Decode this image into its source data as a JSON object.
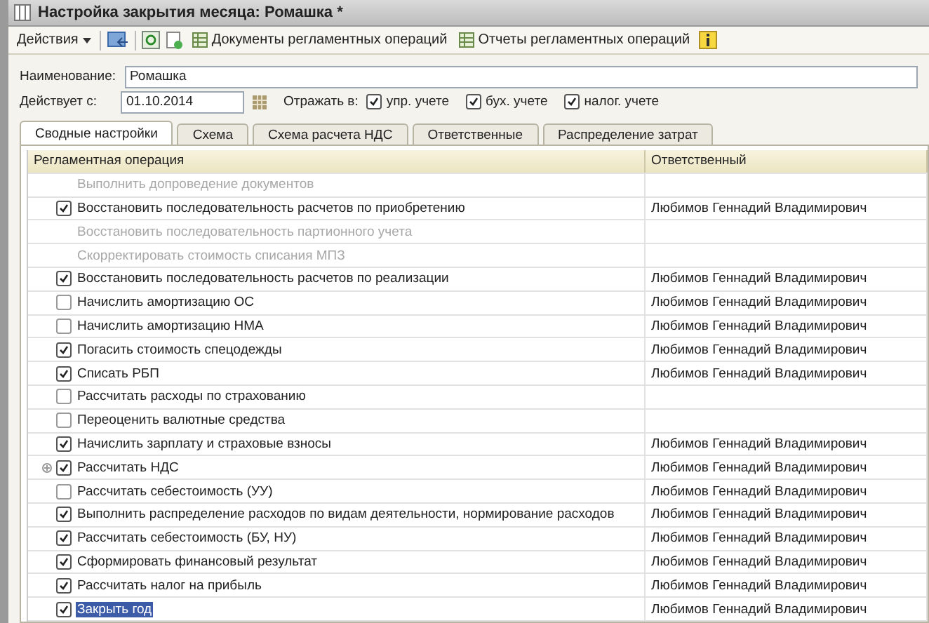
{
  "window": {
    "title": "Настройка закрытия месяца: Ромашка *"
  },
  "toolbar": {
    "actions_menu": "Действия",
    "buttons": [
      {
        "kind": "icon"
      },
      {
        "kind": "icon"
      },
      {
        "kind": "icon"
      },
      {
        "kind": "text",
        "label": "Документы регламентных операций"
      },
      {
        "kind": "text",
        "label": "Отчеты регламентных операций"
      },
      {
        "kind": "icon"
      }
    ]
  },
  "form": {
    "name_label": "Наименование:",
    "name_value": "Ромашка",
    "date_label": "Действует с:",
    "date_value": "01.10.2014",
    "reflect_label": "Отражать в:",
    "reflect": [
      {
        "label": "упр. учете",
        "checked": true
      },
      {
        "label": "бух. учете",
        "checked": true
      },
      {
        "label": "налог. учете",
        "checked": true
      }
    ]
  },
  "tabs": [
    {
      "label": "Сводные настройки",
      "selected": true
    },
    {
      "label": "Схема",
      "selected": false
    },
    {
      "label": "Схема расчета НДС",
      "selected": false
    },
    {
      "label": "Ответственные",
      "selected": false
    },
    {
      "label": "Распределение затрат",
      "selected": false
    }
  ],
  "table": {
    "columns": [
      "Регламентная операция",
      "Ответственный"
    ],
    "rows": [
      {
        "operation": "Выполнить допроведение документов",
        "disabled": true,
        "responsible": "",
        "selected": false
      },
      {
        "operation": "Восстановить последовательность расчетов по приобретению",
        "disabled": false,
        "checked": true,
        "responsible": "Любимов Геннадий Владимирович",
        "selected": false
      },
      {
        "operation": "Восстановить последовательность партионного учета",
        "disabled": true,
        "responsible": "",
        "selected": false
      },
      {
        "operation": "Скорректировать стоимость списания МПЗ",
        "disabled": true,
        "responsible": "",
        "selected": false
      },
      {
        "operation": "Восстановить последовательность расчетов по реализации",
        "disabled": false,
        "checked": true,
        "responsible": "Любимов Геннадий Владимирович",
        "selected": false
      },
      {
        "operation": "Начислить амортизацию ОС",
        "disabled": false,
        "checked": false,
        "responsible": "Любимов Геннадий Владимирович",
        "selected": false
      },
      {
        "operation": "Начислить амортизацию НМА",
        "disabled": false,
        "checked": false,
        "responsible": "Любимов Геннадий Владимирович",
        "selected": false
      },
      {
        "operation": "Погасить стоимость спецодежды",
        "disabled": false,
        "checked": true,
        "responsible": "Любимов Геннадий Владимирович",
        "selected": false
      },
      {
        "operation": "Списать РБП",
        "disabled": false,
        "checked": true,
        "responsible": "Любимов Геннадий Владимирович",
        "selected": false
      },
      {
        "operation": "Рассчитать расходы по страхованию",
        "disabled": false,
        "checked": false,
        "responsible": "",
        "selected": false
      },
      {
        "operation": "Переоценить валютные средства",
        "disabled": false,
        "checked": false,
        "responsible": "",
        "selected": false
      },
      {
        "operation": "Начислить зарплату и страховые взносы",
        "disabled": false,
        "checked": true,
        "responsible": "Любимов Геннадий Владимирович",
        "selected": false
      },
      {
        "operation": "Рассчитать НДС",
        "disabled": false,
        "checked": true,
        "expandable": true,
        "responsible": "Любимов Геннадий Владимирович",
        "selected": false
      },
      {
        "operation": "Рассчитать себестоимость (УУ)",
        "disabled": false,
        "checked": false,
        "responsible": "Любимов Геннадий Владимирович",
        "selected": false
      },
      {
        "operation": "Выполнить распределение расходов по видам деятельности, нормирование расходов",
        "disabled": false,
        "checked": true,
        "responsible": "Любимов Геннадий Владимирович",
        "selected": false
      },
      {
        "operation": "Рассчитать себестоимость (БУ, НУ)",
        "disabled": false,
        "checked": true,
        "responsible": "Любимов Геннадий Владимирович",
        "selected": false
      },
      {
        "operation": "Сформировать финансовый результат",
        "disabled": false,
        "checked": true,
        "responsible": "Любимов Геннадий Владимирович",
        "selected": false
      },
      {
        "operation": "Рассчитать налог на прибыль",
        "disabled": false,
        "checked": true,
        "responsible": "Любимов Геннадий Владимирович",
        "selected": false
      },
      {
        "operation": "Закрыть год",
        "disabled": false,
        "checked": true,
        "responsible": "Любимов Геннадий Владимирович",
        "selected": true
      }
    ]
  }
}
